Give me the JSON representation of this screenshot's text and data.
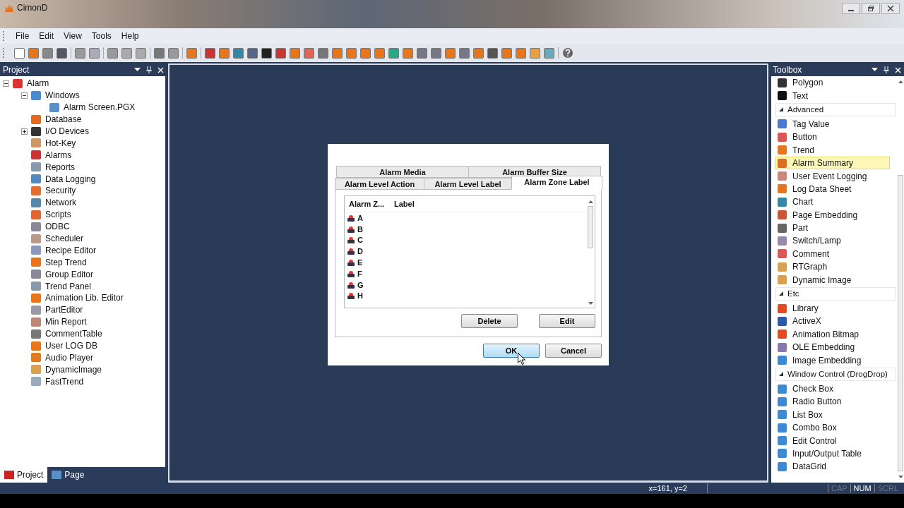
{
  "window": {
    "title": "CimonD"
  },
  "menu": [
    "File",
    "Edit",
    "View",
    "Tools",
    "Help"
  ],
  "project_panel": {
    "title": "Project",
    "tree": [
      {
        "label": "Alarm",
        "expanded": true,
        "children": [
          {
            "label": "Windows",
            "expanded": true,
            "children": [
              {
                "label": "Alarm Screen.PGX"
              }
            ]
          },
          {
            "label": "Database"
          },
          {
            "label": "I/O Devices",
            "expanded": false
          },
          {
            "label": "Hot-Key"
          },
          {
            "label": "Alarms"
          },
          {
            "label": "Reports"
          },
          {
            "label": "Data Logging"
          },
          {
            "label": "Security"
          },
          {
            "label": "Network"
          },
          {
            "label": "Scripts"
          },
          {
            "label": "ODBC"
          },
          {
            "label": "Scheduler"
          },
          {
            "label": "Recipe Editor"
          },
          {
            "label": "Step Trend"
          },
          {
            "label": "Group Editor"
          },
          {
            "label": "Trend Panel"
          },
          {
            "label": "Animation Lib. Editor"
          },
          {
            "label": "PartEditor"
          },
          {
            "label": "Min Report"
          },
          {
            "label": "CommentTable"
          },
          {
            "label": "User LOG DB"
          },
          {
            "label": "Audio Player"
          },
          {
            "label": "DynamicImage"
          },
          {
            "label": "FastTrend"
          }
        ]
      }
    ],
    "tabs": [
      {
        "label": "Project",
        "selected": true
      },
      {
        "label": "Page",
        "selected": false
      }
    ]
  },
  "dialog": {
    "tab_rows": [
      [
        {
          "label": "Alarm Media",
          "selected": false
        },
        {
          "label": "Alarm Buffer Size",
          "selected": false
        }
      ],
      [
        {
          "label": "Alarm Level Action",
          "selected": false
        },
        {
          "label": "Alarm Level Label",
          "selected": false
        },
        {
          "label": "Alarm Zone Label",
          "selected": true
        }
      ]
    ],
    "columns": [
      "Alarm Z...",
      "Label"
    ],
    "rows": [
      "A",
      "B",
      "C",
      "D",
      "E",
      "F",
      "G",
      "H"
    ],
    "list_buttons": [
      "Delete",
      "Edit"
    ],
    "buttons": [
      {
        "label": "OK",
        "focused": true
      },
      {
        "label": "Cancel",
        "focused": false
      }
    ]
  },
  "toolbox": {
    "title": "Toolbox",
    "groups": [
      {
        "items": [
          {
            "label": "Polygon",
            "selected": false
          },
          {
            "label": "Text",
            "selected": false
          }
        ]
      },
      {
        "heading": "Advanced",
        "items": [
          {
            "label": "Tag Value",
            "selected": false
          },
          {
            "label": "Button",
            "selected": false
          },
          {
            "label": "Trend",
            "selected": false
          },
          {
            "label": "Alarm Summary",
            "selected": true
          },
          {
            "label": "User Event Logging",
            "selected": false
          },
          {
            "label": "Log Data Sheet",
            "selected": false
          },
          {
            "label": "Chart",
            "selected": false
          },
          {
            "label": "Page Embedding",
            "selected": false
          },
          {
            "label": "Part",
            "selected": false
          },
          {
            "label": "Switch/Lamp",
            "selected": false
          },
          {
            "label": "Comment",
            "selected": false
          },
          {
            "label": "RTGraph",
            "selected": false
          },
          {
            "label": "Dynamic Image",
            "selected": false
          }
        ]
      },
      {
        "heading": "Etc",
        "items": [
          {
            "label": "Library",
            "selected": false
          },
          {
            "label": "ActiveX",
            "selected": false
          },
          {
            "label": "Animation Bitmap",
            "selected": false
          },
          {
            "label": "OLE Embedding",
            "selected": false
          },
          {
            "label": "Image Embedding",
            "selected": false
          }
        ]
      },
      {
        "heading": "Window Control (DrogDrop)",
        "items": [
          {
            "label": "Check Box",
            "selected": false
          },
          {
            "label": "Radio Button",
            "selected": false
          },
          {
            "label": "List Box",
            "selected": false
          },
          {
            "label": "Combo Box",
            "selected": false
          },
          {
            "label": "Edit Control",
            "selected": false
          },
          {
            "label": "Input/Output Table",
            "selected": false
          },
          {
            "label": "DataGrid",
            "selected": false
          }
        ]
      }
    ]
  },
  "status_bar": {
    "position": "x=161, y=2",
    "indicators": [
      {
        "label": "CAP",
        "on": false
      },
      {
        "label": "NUM",
        "on": true
      },
      {
        "label": "SCRL",
        "on": false
      }
    ]
  }
}
